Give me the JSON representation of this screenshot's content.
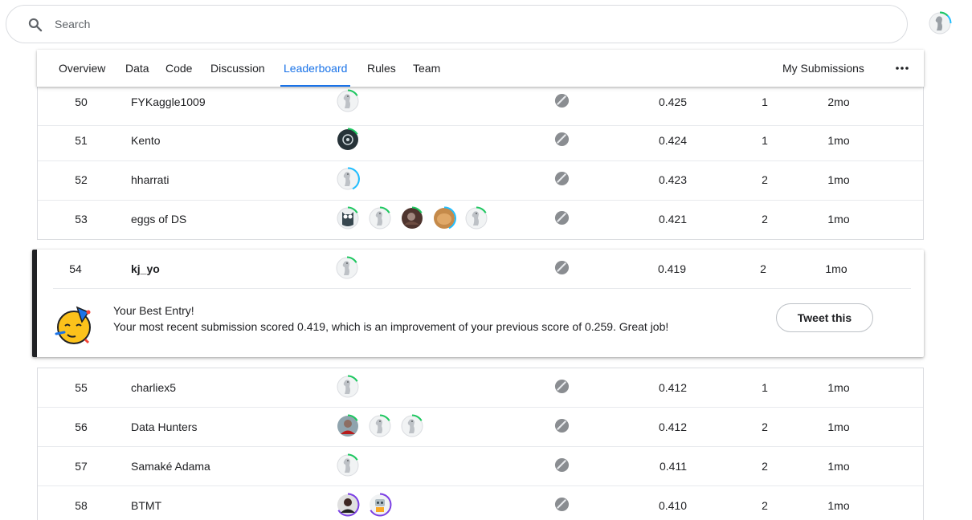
{
  "search": {
    "placeholder": "Search",
    "value": ""
  },
  "user": {
    "avatar": "user-avatar-icon"
  },
  "tabs": [
    {
      "label": "Overview",
      "active": false
    },
    {
      "label": "Data",
      "active": false
    },
    {
      "label": "Code",
      "active": false
    },
    {
      "label": "Discussion",
      "active": false
    },
    {
      "label": "Leaderboard",
      "active": true
    },
    {
      "label": "Rules",
      "active": false
    },
    {
      "label": "Team",
      "active": false
    }
  ],
  "my_submissions_label": "My Submissions",
  "accent_color": "#1a73e8",
  "rows_top": [
    {
      "rank": "50",
      "team": "FYKaggle1009",
      "score": "0.425",
      "entries": "1",
      "last": "2mo"
    },
    {
      "rank": "51",
      "team": "Kento",
      "score": "0.424",
      "entries": "1",
      "last": "1mo"
    },
    {
      "rank": "52",
      "team": "hharrati",
      "score": "0.423",
      "entries": "2",
      "last": "1mo"
    },
    {
      "rank": "53",
      "team": "eggs of DS",
      "score": "0.421",
      "entries": "2",
      "last": "1mo"
    }
  ],
  "my_row": {
    "rank": "54",
    "team": "kj_yo",
    "score": "0.419",
    "entries": "2",
    "last": "1mo"
  },
  "best_entry": {
    "title": "Your Best Entry!",
    "message": "Your most recent submission scored 0.419, which is an improvement of your previous score of 0.259. Great job!",
    "tweet_label": "Tweet this"
  },
  "rows_bottom": [
    {
      "rank": "55",
      "team": "charliex5",
      "score": "0.412",
      "entries": "1",
      "last": "1mo"
    },
    {
      "rank": "56",
      "team": "Data Hunters",
      "score": "0.412",
      "entries": "2",
      "last": "1mo"
    },
    {
      "rank": "57",
      "team": "Samaké Adama",
      "score": "0.411",
      "entries": "2",
      "last": "1mo"
    },
    {
      "rank": "58",
      "team": "BTMT",
      "score": "0.410",
      "entries": "2",
      "last": "1mo"
    }
  ]
}
